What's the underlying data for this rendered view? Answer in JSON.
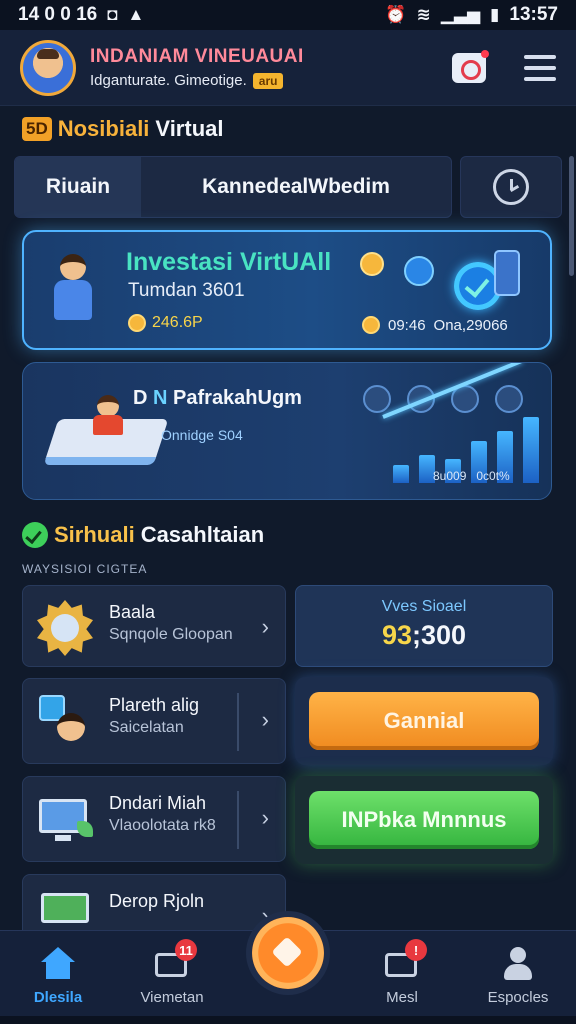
{
  "status_bar": {
    "left": "14 0 0 16",
    "time": "13:57"
  },
  "header": {
    "title": "INDANIAM VINEUAUAI",
    "subtitle": "Idganturate. Gimeotige.",
    "badge": "aru"
  },
  "section1": {
    "prefix_badge": "5D",
    "prefix": "Nosibiali",
    "title": "Virtual"
  },
  "tabs": [
    {
      "label": "Riuain"
    },
    {
      "label": "KannedealWbedim"
    }
  ],
  "card_invest": {
    "title": "Investasi VirtUAll",
    "subtitle": "Tumdan 3601",
    "value": "246.6P",
    "stat_a": "09:46",
    "stat_b": "Ona,29066"
  },
  "card_promo": {
    "title_prefix": "D",
    "title_highlight": "N",
    "title_rest": "PafrakahUgm",
    "subtitle": "Onnidge S04",
    "stat_a": "8u009",
    "stat_b": "0c0t%"
  },
  "section2": {
    "prefix": "Sirhuali",
    "title": "Casahltaian",
    "micro_label": "WAYSISIOI CIGTEA"
  },
  "list_items": [
    {
      "title": "Baala",
      "subtitle": "Sqnqole Gloopan"
    },
    {
      "title": "Plareth alig",
      "subtitle": "Saicelatan"
    },
    {
      "title": "Dndari Miah",
      "subtitle": "Vlaoolotata rk8"
    },
    {
      "title": "Derop Rjoln",
      "subtitle": ""
    }
  ],
  "balance": {
    "label": "Vves Sioael",
    "value_highlight": "93",
    "value_rest": ";300"
  },
  "buttons": {
    "orange": "Gannial",
    "green": "INPbka Mnnnus"
  },
  "bottom_nav": [
    {
      "label": "Dlesila",
      "badge": ""
    },
    {
      "label": "Viemetan",
      "badge": "11"
    },
    {
      "label": "Mesl",
      "badge": "!"
    },
    {
      "label": "Espocles",
      "badge": ""
    }
  ],
  "colors": {
    "background": "#101a2b",
    "accent_blue": "#3fa7ff",
    "accent_orange": "#f08a1f",
    "accent_green": "#34b43e",
    "highlight_teal": "#49e3c2"
  }
}
